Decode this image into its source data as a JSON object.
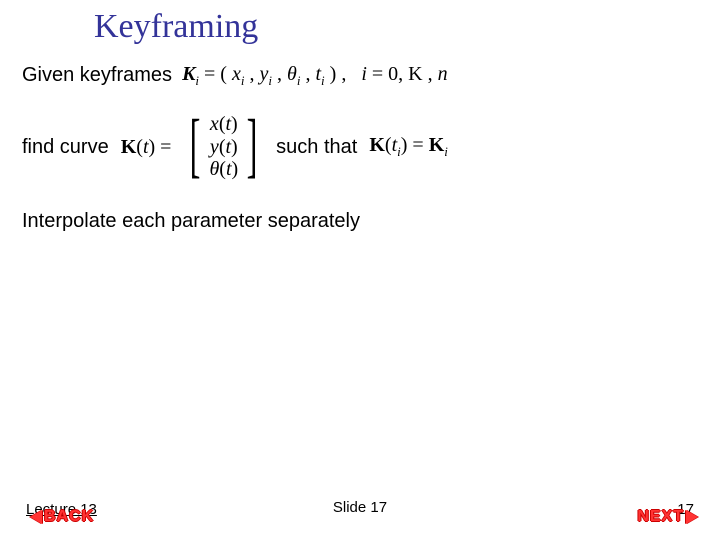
{
  "title": "Keyframing",
  "line1_text": "Given keyframes",
  "line1_math": "K_i = ( x_i , y_i , θ_i , t_i ) ,   i = 0, K , n",
  "line2_text_a": "find curve",
  "line2_math_lhs": "K(t) =",
  "line2_vec_rows": [
    "x(t)",
    "y(t)",
    "θ(t)"
  ],
  "line2_text_b": "such that",
  "line2_math_rhs": "K(t_i) = K_i",
  "line3_text": "Interpolate each parameter separately",
  "footer": {
    "lecture": "Lecture 13",
    "slide": "Slide 17",
    "page": "17",
    "back": "Back",
    "next": "Next"
  }
}
